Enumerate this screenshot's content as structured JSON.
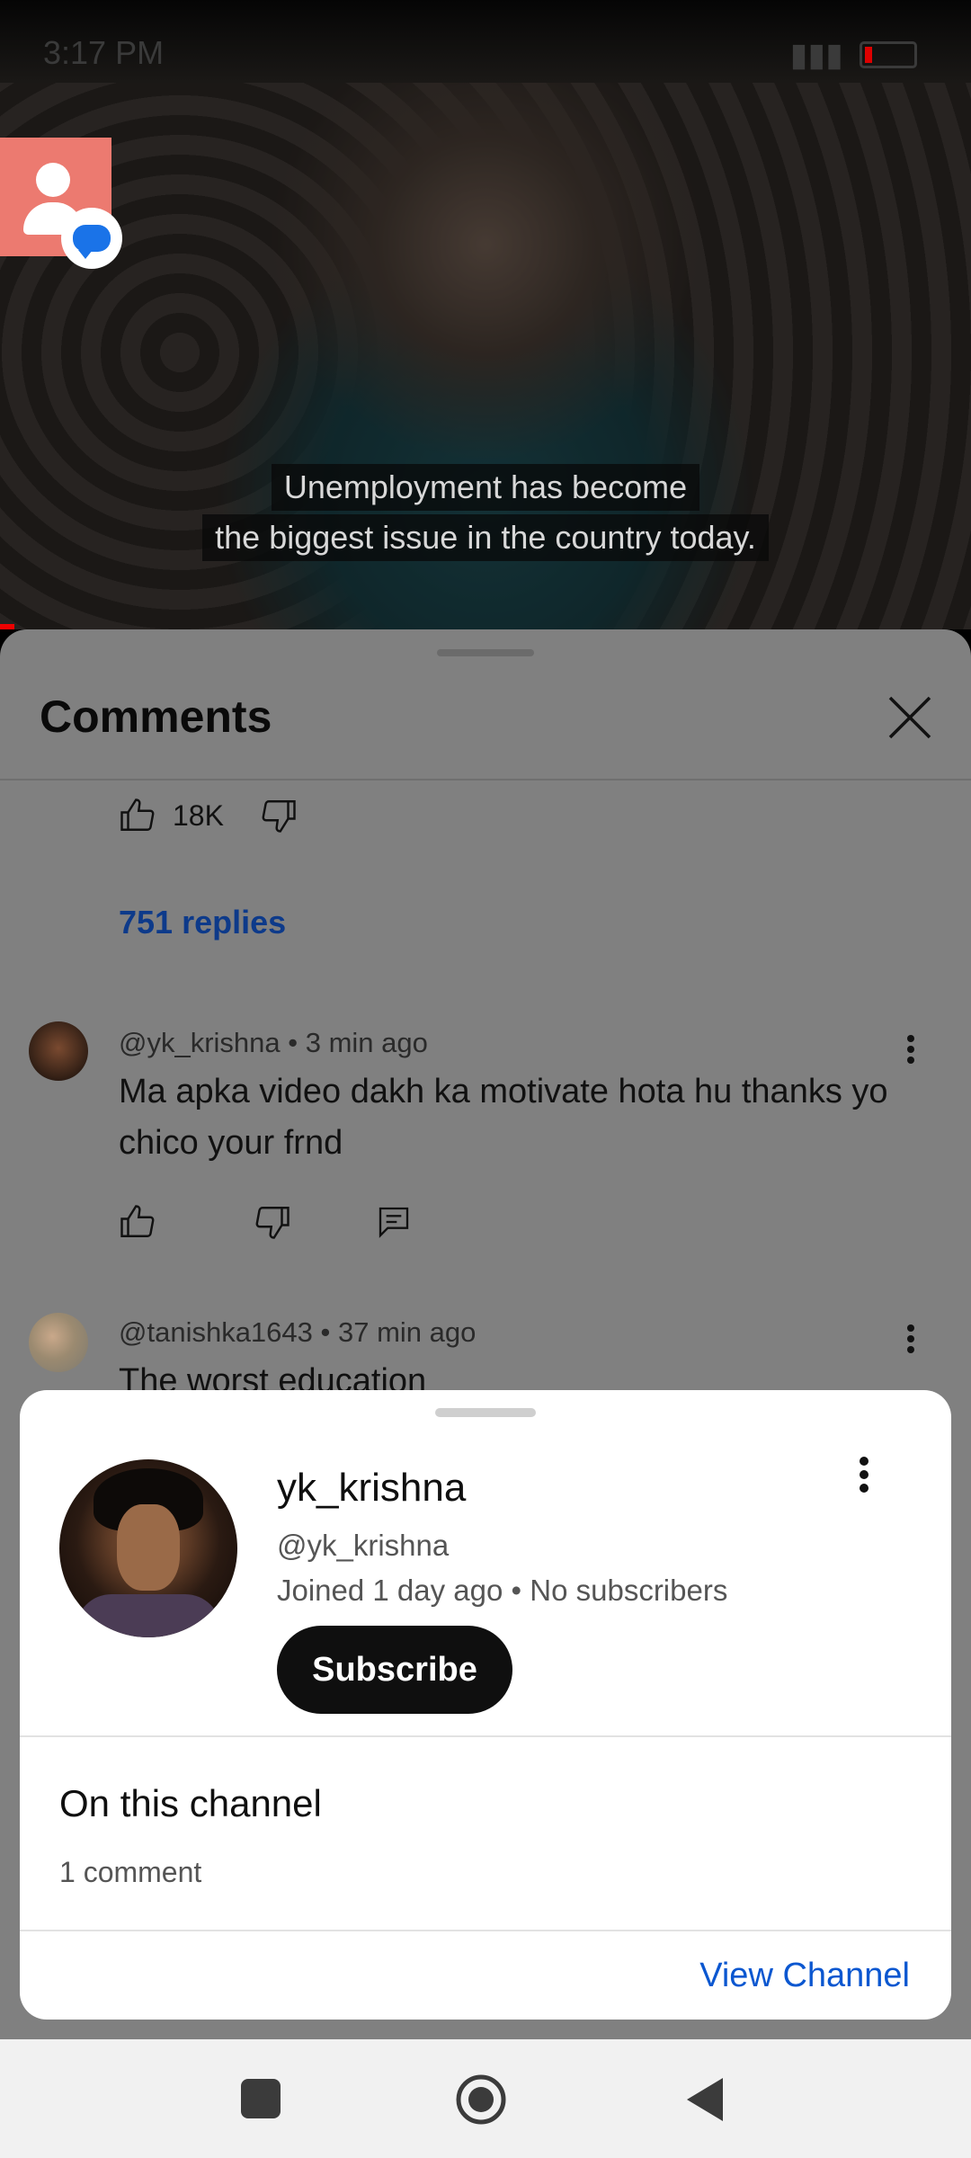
{
  "status_bar": {
    "time": "3:17 PM"
  },
  "video": {
    "caption_line1": "Unemployment has become",
    "caption_line2": "the biggest issue in the country today."
  },
  "comments": {
    "title": "Comments",
    "top_comment": {
      "like_count": "18K",
      "replies_label": "751 replies"
    },
    "items": [
      {
        "meta": "@yk_krishna • 3 min ago",
        "text": "Ma apka video dakh ka motivate hota hu thanks yo chico your frnd"
      },
      {
        "meta": "@tanishka1643 • 37 min ago",
        "text": "The worst education"
      }
    ]
  },
  "channel_card": {
    "name": "yk_krishna",
    "handle": "@yk_krishna",
    "joined": "Joined 1 day ago • No subscribers",
    "subscribe_label": "Subscribe",
    "section_title": "On this channel",
    "section_sub": "1 comment",
    "view_channel_label": "View Channel"
  },
  "colors": {
    "link_blue": "#0b57d0",
    "replies_blue": "#0d3a8a",
    "dim_overlay": "#808080"
  },
  "icons": [
    "like-icon",
    "dislike-icon",
    "reply-icon",
    "close-icon",
    "more-vert-icon",
    "recents-icon",
    "home-icon",
    "back-icon"
  ]
}
